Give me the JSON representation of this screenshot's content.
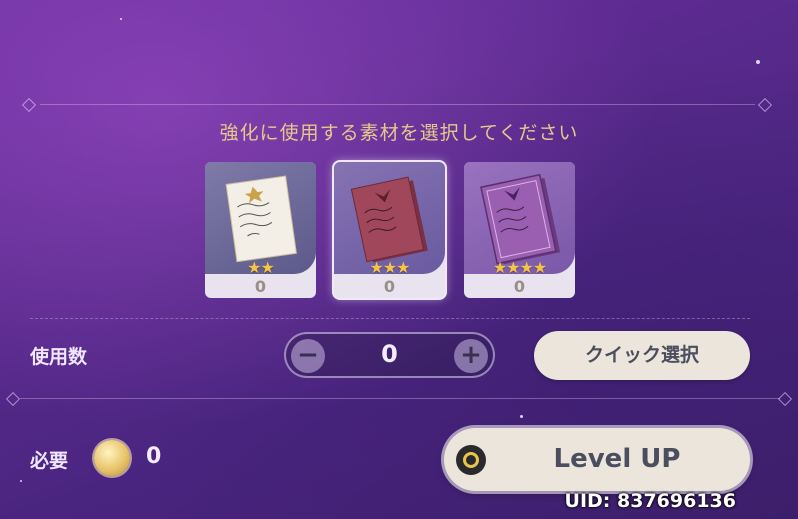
{
  "prompt": "強化に使用する素材を選択してください",
  "materials": [
    {
      "rarity_stars": "★★",
      "count": "0",
      "selected": false
    },
    {
      "rarity_stars": "★★★",
      "count": "0",
      "selected": true
    },
    {
      "rarity_stars": "★★★★",
      "count": "0",
      "selected": false
    }
  ],
  "usage": {
    "label": "使用数",
    "value": "0",
    "minus_symbol": "−",
    "plus_symbol": "+",
    "quick_select_label": "クイック選択"
  },
  "cost": {
    "label": "必要",
    "coin_icon": "mora-coin-icon",
    "value": "0"
  },
  "level_up": {
    "label": "Level UP"
  },
  "uid": "UID: 837696136",
  "colors": {
    "prompt": "#e6c88b",
    "button_bg": "#ece5dc",
    "button_text": "#4a4e5e",
    "star": "#f4c542"
  }
}
